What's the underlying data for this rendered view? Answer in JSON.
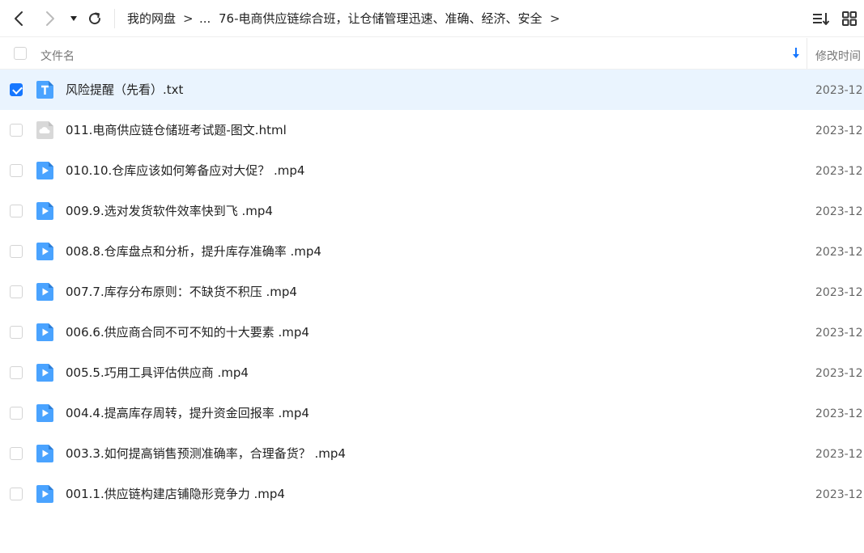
{
  "toolbar": {
    "back_icon": "chevron-left-icon",
    "forward_icon": "chevron-right-icon",
    "history_icon": "caret-down-icon",
    "refresh_icon": "refresh-icon",
    "breadcrumb": {
      "root": "我的网盘",
      "ellipsis": "...",
      "current": "76-电商供应链综合班，让仓储管理迅速、准确、经济、安全",
      "separator": ">"
    },
    "sort_icon": "sort-list-icon",
    "view_icon": "grid-view-icon"
  },
  "header": {
    "name_label": "文件名",
    "sort_icon": "sort-down-arrow-icon",
    "time_label": "修改时间"
  },
  "colors": {
    "accent": "#1677ff",
    "selected_row": "#eaf4fe",
    "file_icon_blue": "#4aa3ff",
    "html_icon_gray": "#d8d8d8"
  },
  "files": [
    {
      "name": "风险提醒（先看）.txt",
      "time": "2023-12",
      "type": "txt",
      "checked": true
    },
    {
      "name": "011.电商供应链仓储班考试题-图文.html",
      "time": "2023-12",
      "type": "html",
      "checked": false
    },
    {
      "name": "010.10.仓库应该如何筹备应对大促？ .mp4",
      "time": "2023-12",
      "type": "video",
      "checked": false
    },
    {
      "name": "009.9.选对发货软件效率快到飞 .mp4",
      "time": "2023-12",
      "type": "video",
      "checked": false
    },
    {
      "name": "008.8.仓库盘点和分析，提升库存准确率 .mp4",
      "time": "2023-12",
      "type": "video",
      "checked": false
    },
    {
      "name": "007.7.库存分布原则：不缺货不积压 .mp4",
      "time": "2023-12",
      "type": "video",
      "checked": false
    },
    {
      "name": "006.6.供应商合同不可不知的十大要素 .mp4",
      "time": "2023-12",
      "type": "video",
      "checked": false
    },
    {
      "name": "005.5.巧用工具评估供应商 .mp4",
      "time": "2023-12",
      "type": "video",
      "checked": false
    },
    {
      "name": "004.4.提高库存周转，提升资金回报率 .mp4",
      "time": "2023-12",
      "type": "video",
      "checked": false
    },
    {
      "name": "003.3.如何提高销售预测准确率，合理备货？ .mp4",
      "time": "2023-12",
      "type": "video",
      "checked": false
    },
    {
      "name": "001.1.供应链构建店铺隐形竞争力 .mp4",
      "time": "2023-12",
      "type": "video",
      "checked": false
    }
  ]
}
